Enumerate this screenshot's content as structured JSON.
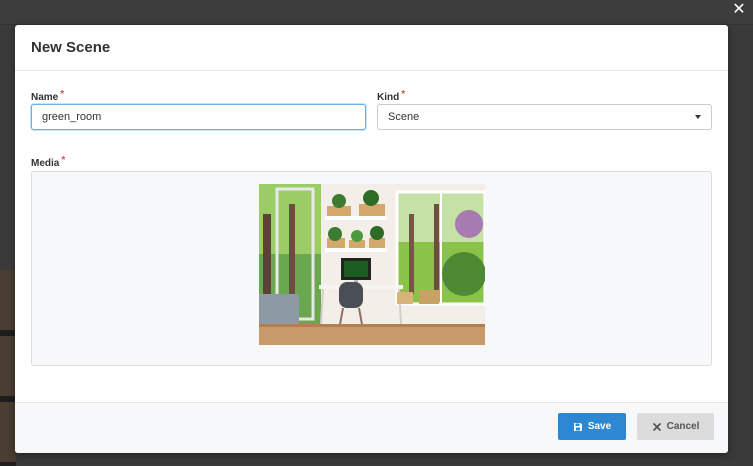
{
  "modal": {
    "title": "New Scene",
    "close_glyph": "✕"
  },
  "form": {
    "name_label": "Name",
    "name_value": "green_room",
    "kind_label": "Kind",
    "kind_value": "Scene",
    "media_label": "Media",
    "required_mark": "*"
  },
  "actions": {
    "save_label": "Save",
    "cancel_label": "Cancel"
  },
  "icons": {
    "save": "floppy-disk-icon",
    "cancel": "x-icon",
    "kind_dropdown": "caret-down-icon"
  },
  "colors": {
    "primary": "#2d88d1",
    "required": "#d9534f",
    "focus": "#66afe9"
  }
}
